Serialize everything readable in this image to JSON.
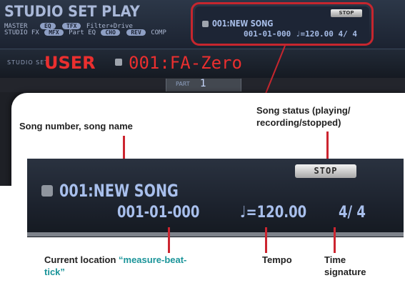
{
  "screen": {
    "title": "STUDIO SET PLAY",
    "master_label": "MASTER",
    "studio_fx_label": "STUDIO FX",
    "eq_pill": "EQ",
    "tfx_pill": "TFX",
    "filter_drive": "Filter+Drive",
    "mfx_pill": "MFX",
    "part_eq_label": "Part EQ",
    "cho_pill": "CHO",
    "rev_pill": "REV",
    "comp_label": "COMP",
    "studio_set_label": "STUDIO SET",
    "bank": "USER",
    "set_name": "001:FA-Zero",
    "part_label": "PART",
    "part_number": "1"
  },
  "mini_display": {
    "stop": "STOP",
    "song": "001:NEW SONG",
    "location_tempo_time": "001-01-000  ♩=120.00  4/ 4"
  },
  "big_display": {
    "stop": "STOP",
    "song": "001:NEW SONG",
    "location": "001-01-000",
    "tempo": "♩=120.00",
    "time_signature": "4/ 4"
  },
  "annotations": {
    "song_number_name": "Song number, song name",
    "song_status_1": "Song status (playing/",
    "song_status_2": "recording/stopped)",
    "current_location_1": "Current location ",
    "current_location_teal_1": "“measure-beat-",
    "current_location_teal_2": "tick”",
    "tempo": "Tempo",
    "time_sig_1": "Time",
    "time_sig_2": "signature"
  },
  "colors": {
    "highlight_red": "#c6262e",
    "teal": "#1a9499",
    "lcd_text": "#a8bfec",
    "set_red": "#ea2f2f"
  }
}
